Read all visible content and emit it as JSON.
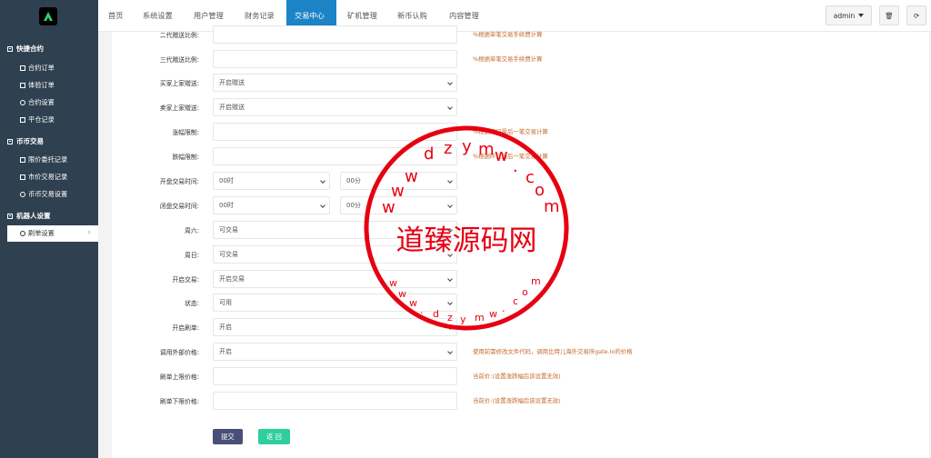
{
  "sidebar": {
    "groups": [
      {
        "label": "快捷合约",
        "items": [
          "合约订单",
          "体验订单",
          "合约设置",
          "平仓记录"
        ]
      },
      {
        "label": "币币交易",
        "items": [
          "限价委托记录",
          "市价交易记录",
          "币币交易设置"
        ]
      },
      {
        "label": "机器人设置",
        "items": [
          "刷单设置"
        ]
      }
    ]
  },
  "topnav": {
    "items": [
      "首页",
      "系统设置",
      "用户管理",
      "财务记录",
      "交易中心",
      "矿机管理",
      "新币认购",
      "内容管理"
    ],
    "active": "交易中心",
    "user": "admin"
  },
  "form": {
    "rows": [
      {
        "label": "二代赠送比例:",
        "value": "",
        "hint": "%根据单笔交易手续费计算"
      },
      {
        "label": "三代赠送比例:",
        "value": "",
        "hint": "%根据单笔交易手续费计算"
      },
      {
        "label": "买家上家赠送:",
        "value": "开启赠送",
        "hint": ""
      },
      {
        "label": "卖家上家赠送:",
        "value": "开启赠送",
        "hint": ""
      },
      {
        "label": "涨幅限制:",
        "value": "",
        "hint": "%根据昨日最后一笔交易计算"
      },
      {
        "label": "跌幅限制:",
        "value": "",
        "hint": "%根据昨日最后一笔交易计算"
      },
      {
        "label": "开盘交易时间:",
        "value": "00时",
        "value2": "00分",
        "hint": ""
      },
      {
        "label": "闭盘交易时间:",
        "value": "00时",
        "value2": "00分",
        "hint": ""
      },
      {
        "label": "周六:",
        "value": "可交易",
        "hint": ""
      },
      {
        "label": "周日:",
        "value": "可交易",
        "hint": ""
      },
      {
        "label": "开启交易:",
        "value": "开启交易",
        "hint": ""
      },
      {
        "label": "状态:",
        "value": "可用",
        "hint": ""
      },
      {
        "label": "开启刷单:",
        "value": "开启",
        "hint": ""
      },
      {
        "label": "调用外部价格:",
        "value": "开启",
        "hint": "使用前需修改文件代码，调用比特儿海外交易所gate.io的价格"
      },
      {
        "label": "刷单上限价格:",
        "value": "",
        "hint": "当前价:(设置涨跌幅后该设置无效)"
      },
      {
        "label": "刷单下限价格:",
        "value": "",
        "hint": "当前价:(设置涨跌幅后该设置无效)"
      }
    ],
    "submit": "提交",
    "back": "返 回"
  },
  "watermark": {
    "text": "道臻源码网",
    "url": "www.dzymw.com",
    "color": "#e60012"
  }
}
